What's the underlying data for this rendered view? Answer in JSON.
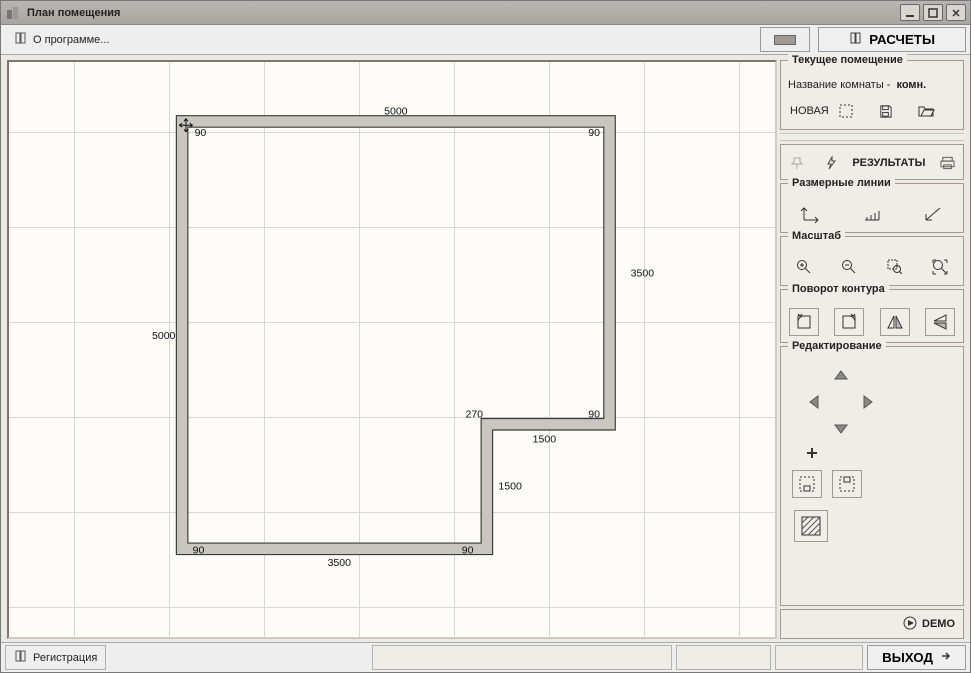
{
  "window": {
    "title": "План помещения"
  },
  "toolbar": {
    "about": "О программе...",
    "calc": "РАСЧЕТЫ"
  },
  "panels": {
    "current_room": {
      "legend": "Текущее помещение",
      "room_label": "Название комнаты -",
      "room_value": "комн.",
      "new_btn": "НОВАЯ"
    },
    "results_btn": "РЕЗУЛЬТАТЫ",
    "dim_lines": {
      "legend": "Размерные линии"
    },
    "scale": {
      "legend": "Масштаб"
    },
    "rotate": {
      "legend": "Поворот контура"
    },
    "edit": {
      "legend": "Редактирование"
    }
  },
  "demo": "DEMO",
  "statusbar": {
    "register": "Регистрация",
    "exit": "ВЫХОД"
  },
  "plan": {
    "dims": {
      "top_5000": "5000",
      "left_5000": "5000",
      "right_3500": "3500",
      "notch_270": "270",
      "notch_1500_h": "1500",
      "notch_1500_v": "1500",
      "bottom_3500": "3500"
    },
    "angles": {
      "tl": "90",
      "tr": "90",
      "mr": "90",
      "mc": "90",
      "bl": "90",
      "bc": "90"
    }
  }
}
